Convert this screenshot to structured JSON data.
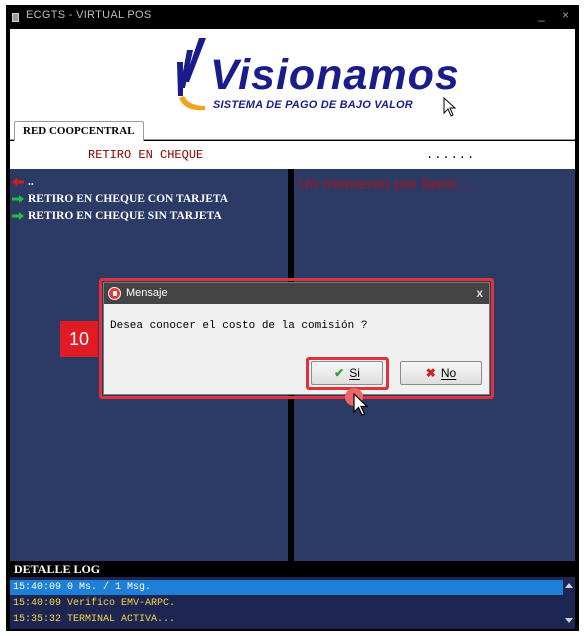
{
  "window": {
    "title": "ECGTS - VIRTUAL POS",
    "minimize": "_",
    "close": "×"
  },
  "banner": {
    "logo_text": "Visionamos",
    "logo_subtitle": "SISTEMA DE PAGO DE BAJO VALOR"
  },
  "tabs": [
    {
      "label": "RED COOPCENTRAL"
    }
  ],
  "operation": {
    "title": "RETIRO EN CHEQUE",
    "status": "......"
  },
  "menu": {
    "back_label": "..",
    "items": [
      {
        "label": "RETIRO EN CHEQUE CON TARJETA"
      },
      {
        "label": "RETIRO EN CHEQUE SIN TARJETA"
      }
    ]
  },
  "wait_message": "Un momento por favor...",
  "dialog": {
    "title": "Mensaje",
    "close": "x",
    "message": "Desea conocer el costo de la comisión ?",
    "yes_label": "Si",
    "no_label": "No"
  },
  "step_badge": "10",
  "log": {
    "header": "DETALLE LOG",
    "lines": [
      "15:40:09 0 Ms. / 1 Msg.",
      "15:40:09 Verifico EMV-ARPC.",
      "15:35:32 TERMINAL ACTIVA..."
    ]
  },
  "colors": {
    "main_bg": "#2c3a66",
    "operation_title": "#8b0000",
    "wait_message": "#a0141e",
    "log_text": "#f5d742",
    "log_selected": "#1e7fd6",
    "highlight": "#e2313a",
    "logo": "#1a1c8c"
  },
  "icons": {
    "back": "red-arrow-left-icon",
    "menu_item": "green-arrow-right-icon",
    "dialog": "stop-hand-icon",
    "yes": "check-icon",
    "no": "x-icon"
  }
}
